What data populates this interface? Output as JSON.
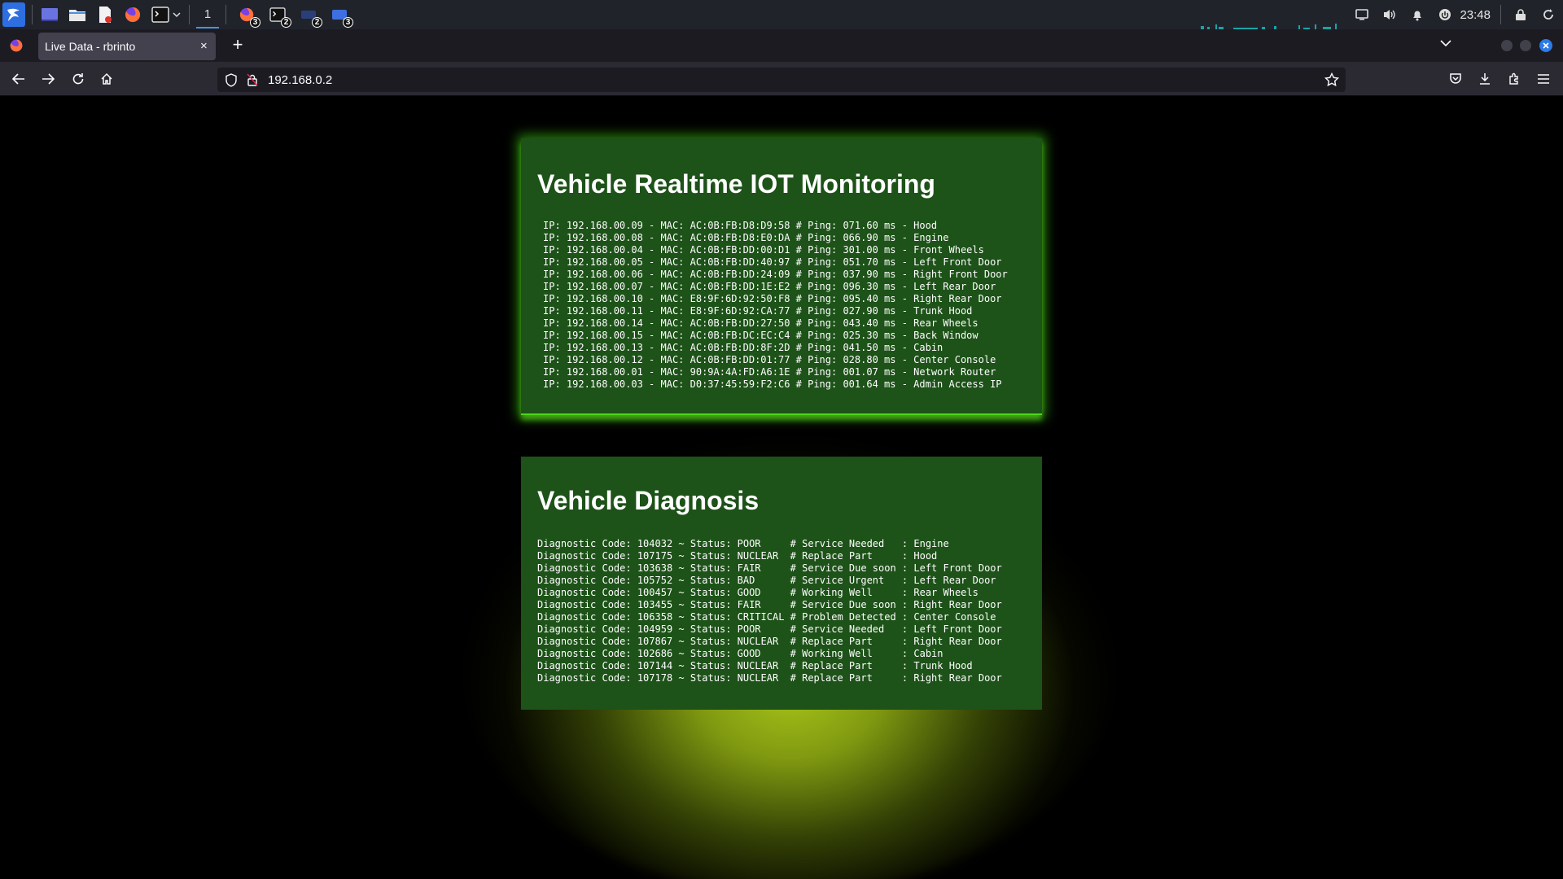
{
  "system_bar": {
    "workspace": "1",
    "badges": {
      "firefox": "3",
      "terminal": "2",
      "app_a": "2",
      "app_b": "3"
    },
    "clock": "23:48"
  },
  "browser": {
    "tab_title": "Live Data - rbrinto",
    "tab_close": "×",
    "new_tab": "+",
    "url": "192.168.0.2"
  },
  "iot": {
    "title": "Vehicle Realtime IOT Monitoring",
    "lines": [
      "IP: 192.168.00.09 - MAC: AC:0B:FB:D8:D9:58 # Ping: 071.60 ms - Hood",
      "IP: 192.168.00.08 - MAC: AC:0B:FB:D8:E0:DA # Ping: 066.90 ms - Engine",
      "IP: 192.168.00.04 - MAC: AC:0B:FB:DD:00:D1 # Ping: 301.00 ms - Front Wheels",
      "IP: 192.168.00.05 - MAC: AC:0B:FB:DD:40:97 # Ping: 051.70 ms - Left Front Door",
      "IP: 192.168.00.06 - MAC: AC:0B:FB:DD:24:09 # Ping: 037.90 ms - Right Front Door",
      "IP: 192.168.00.07 - MAC: AC:0B:FB:DD:1E:E2 # Ping: 096.30 ms - Left Rear Door",
      "IP: 192.168.00.10 - MAC: E8:9F:6D:92:50:F8 # Ping: 095.40 ms - Right Rear Door",
      "IP: 192.168.00.11 - MAC: E8:9F:6D:92:CA:77 # Ping: 027.90 ms - Trunk Hood",
      "IP: 192.168.00.14 - MAC: AC:0B:FB:DD:27:50 # Ping: 043.40 ms - Rear Wheels",
      "IP: 192.168.00.15 - MAC: AC:0B:FB:DC:EC:C4 # Ping: 025.30 ms - Back Window",
      "IP: 192.168.00.13 - MAC: AC:0B:FB:DD:8F:2D # Ping: 041.50 ms - Cabin",
      "IP: 192.168.00.12 - MAC: AC:0B:FB:DD:01:77 # Ping: 028.80 ms - Center Console",
      "IP: 192.168.00.01 - MAC: 90:9A:4A:FD:A6:1E # Ping: 001.07 ms - Network Router",
      "IP: 192.168.00.03 - MAC: D0:37:45:59:F2:C6 # Ping: 001.64 ms - Admin Access IP"
    ]
  },
  "diagnosis": {
    "title": "Vehicle Diagnosis",
    "lines": [
      "Diagnostic Code: 104032 ~ Status: POOR     # Service Needed   : Engine",
      "Diagnostic Code: 107175 ~ Status: NUCLEAR  # Replace Part     : Hood",
      "Diagnostic Code: 103638 ~ Status: FAIR     # Service Due soon : Left Front Door",
      "Diagnostic Code: 105752 ~ Status: BAD      # Service Urgent   : Left Rear Door",
      "Diagnostic Code: 100457 ~ Status: GOOD     # Working Well     : Rear Wheels",
      "Diagnostic Code: 103455 ~ Status: FAIR     # Service Due soon : Right Rear Door",
      "Diagnostic Code: 106358 ~ Status: CRITICAL # Problem Detected : Center Console",
      "Diagnostic Code: 104959 ~ Status: POOR     # Service Needed   : Left Front Door",
      "Diagnostic Code: 107867 ~ Status: NUCLEAR  # Replace Part     : Right Rear Door",
      "Diagnostic Code: 102686 ~ Status: GOOD     # Working Well     : Cabin",
      "Diagnostic Code: 107144 ~ Status: NUCLEAR  # Replace Part     : Trunk Hood",
      "Diagnostic Code: 107178 ~ Status: NUCLEAR  # Replace Part     : Right Rear Door"
    ]
  },
  "colors": {
    "card_bg": "#1d5218",
    "card_glow": "#4fd61b",
    "page_bg": "#000000",
    "glow_yellow": "#aac819",
    "accent_blue": "#2c7be5"
  },
  "icons": {
    "system": [
      "kali-dragon-icon",
      "desktop-icon",
      "file-manager-icon",
      "text-editor-icon",
      "firefox-icon",
      "terminal-icon",
      "chevron-down-icon"
    ],
    "tray": [
      "display-icon",
      "volume-icon",
      "bell-icon",
      "power-icon",
      "lock-icon",
      "refresh-icon"
    ],
    "nav": [
      "back-arrow-icon",
      "forward-arrow-icon",
      "reload-icon",
      "home-icon",
      "shield-icon",
      "lock-icon",
      "star-icon",
      "pocket-icon",
      "download-icon",
      "extensions-icon",
      "menu-icon"
    ]
  }
}
